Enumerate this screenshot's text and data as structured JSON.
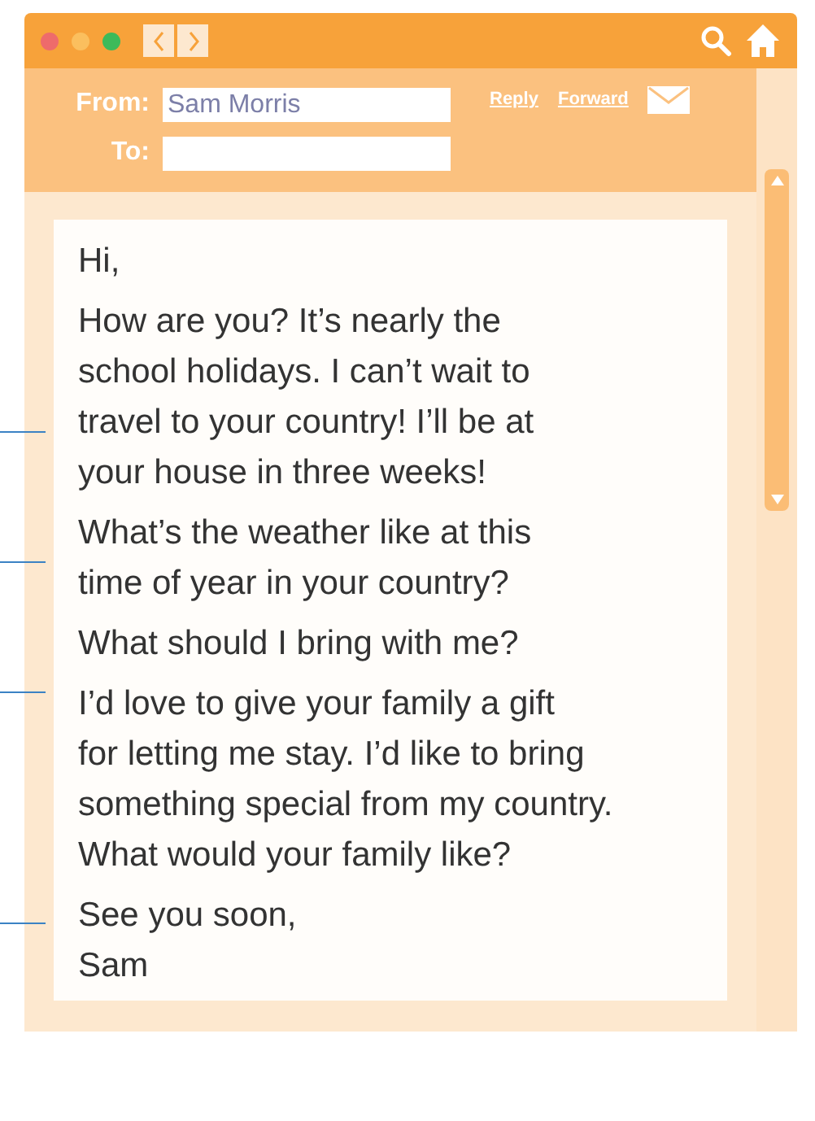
{
  "header": {
    "from_label": "From:",
    "from_value": "Sam Morris",
    "to_label": "To:",
    "links": [
      "Reply",
      "Forward"
    ]
  },
  "message": [
    {
      "lines": [
        "Hi,"
      ]
    },
    {
      "lines": [
        "How are you? It’s nearly the",
        "school holidays. I can’t wait to",
        "travel to your country! I’ll be at",
        "your house in three weeks!"
      ]
    },
    {
      "lines": [
        "What’s the weather like at this",
        "time of year in your country?"
      ]
    },
    {
      "lines": [
        "What should I bring with me?"
      ]
    },
    {
      "lines": [
        "I’d love to give your family a gift",
        "for letting me stay. I’d like to bring",
        "something special from my country.",
        "What would your family like?"
      ]
    },
    {
      "lines": [
        "See you soon,",
        "Sam"
      ]
    }
  ]
}
